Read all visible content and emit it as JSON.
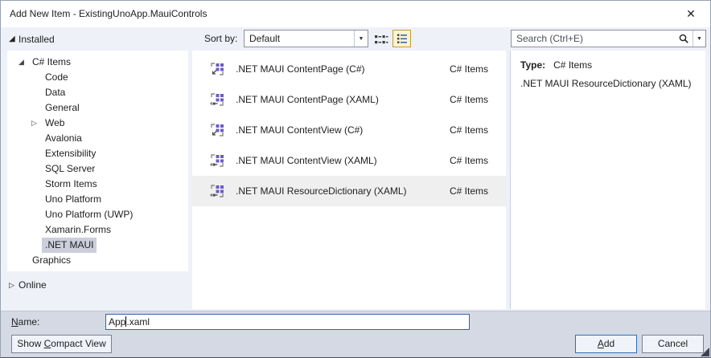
{
  "window": {
    "title": "Add New Item - ExistingUnoApp.MauiControls",
    "close_glyph": "✕"
  },
  "glyphs": {
    "expanded": "◢",
    "collapsed": "▷",
    "combo_arrow": "▼"
  },
  "toolbar": {
    "sort_label": "Sort by:",
    "sort_value": "Default",
    "view_modes": [
      "small-icons-view",
      "list-view"
    ],
    "selected_view": "list-view",
    "search_placeholder": "Search (Ctrl+E)"
  },
  "nav": {
    "installed_label": "Installed",
    "online_label": "Online",
    "tree": [
      {
        "label": "C# Items",
        "level": 0,
        "arrow": "expanded"
      },
      {
        "label": "Code",
        "level": 1
      },
      {
        "label": "Data",
        "level": 1
      },
      {
        "label": "General",
        "level": 1
      },
      {
        "label": "Web",
        "level": 1,
        "arrow": "collapsed"
      },
      {
        "label": "Avalonia",
        "level": 1
      },
      {
        "label": "Extensibility",
        "level": 1
      },
      {
        "label": "SQL Server",
        "level": 1
      },
      {
        "label": "Storm Items",
        "level": 1
      },
      {
        "label": "Uno Platform",
        "level": 1
      },
      {
        "label": "Uno Platform (UWP)",
        "level": 1
      },
      {
        "label": "Xamarin.Forms",
        "level": 1,
        "selectedNote": null
      },
      {
        "label": ".NET MAUI",
        "level": 1,
        "selected": true
      },
      {
        "label": "Graphics",
        "level": 0
      }
    ]
  },
  "list": {
    "items": [
      {
        "name": ".NET MAUI ContentPage (C#)",
        "category": "C# Items",
        "icon": "csharp"
      },
      {
        "name": ".NET MAUI ContentPage (XAML)",
        "category": "C# Items",
        "icon": "xaml"
      },
      {
        "name": ".NET MAUI ContentView (C#)",
        "category": "C# Items",
        "icon": "csharp"
      },
      {
        "name": ".NET MAUI ContentView (XAML)",
        "category": "C# Items",
        "icon": "xaml"
      },
      {
        "name": ".NET MAUI ResourceDictionary (XAML)",
        "category": "C# Items",
        "icon": "xaml",
        "selected": true
      }
    ]
  },
  "detail": {
    "type_label": "Type:",
    "type_value": "C# Items",
    "description": ".NET MAUI ResourceDictionary (XAML)"
  },
  "footer": {
    "name_label_u": "N",
    "name_label_rest": "ame:",
    "name_before_caret": "App",
    "name_after_caret": ".xaml",
    "compact_pre": "Show ",
    "compact_u": "C",
    "compact_rest": "ompact View",
    "add_u": "A",
    "add_rest": "dd",
    "cancel_label": "Cancel"
  },
  "colors": {
    "accent_blue": "#2c6fb7",
    "selection_gray": "#cccedb",
    "toggle_highlight": "#fdf4cd",
    "toggle_border": "#c49a3c",
    "purple_icon": "#6e5cc3"
  }
}
